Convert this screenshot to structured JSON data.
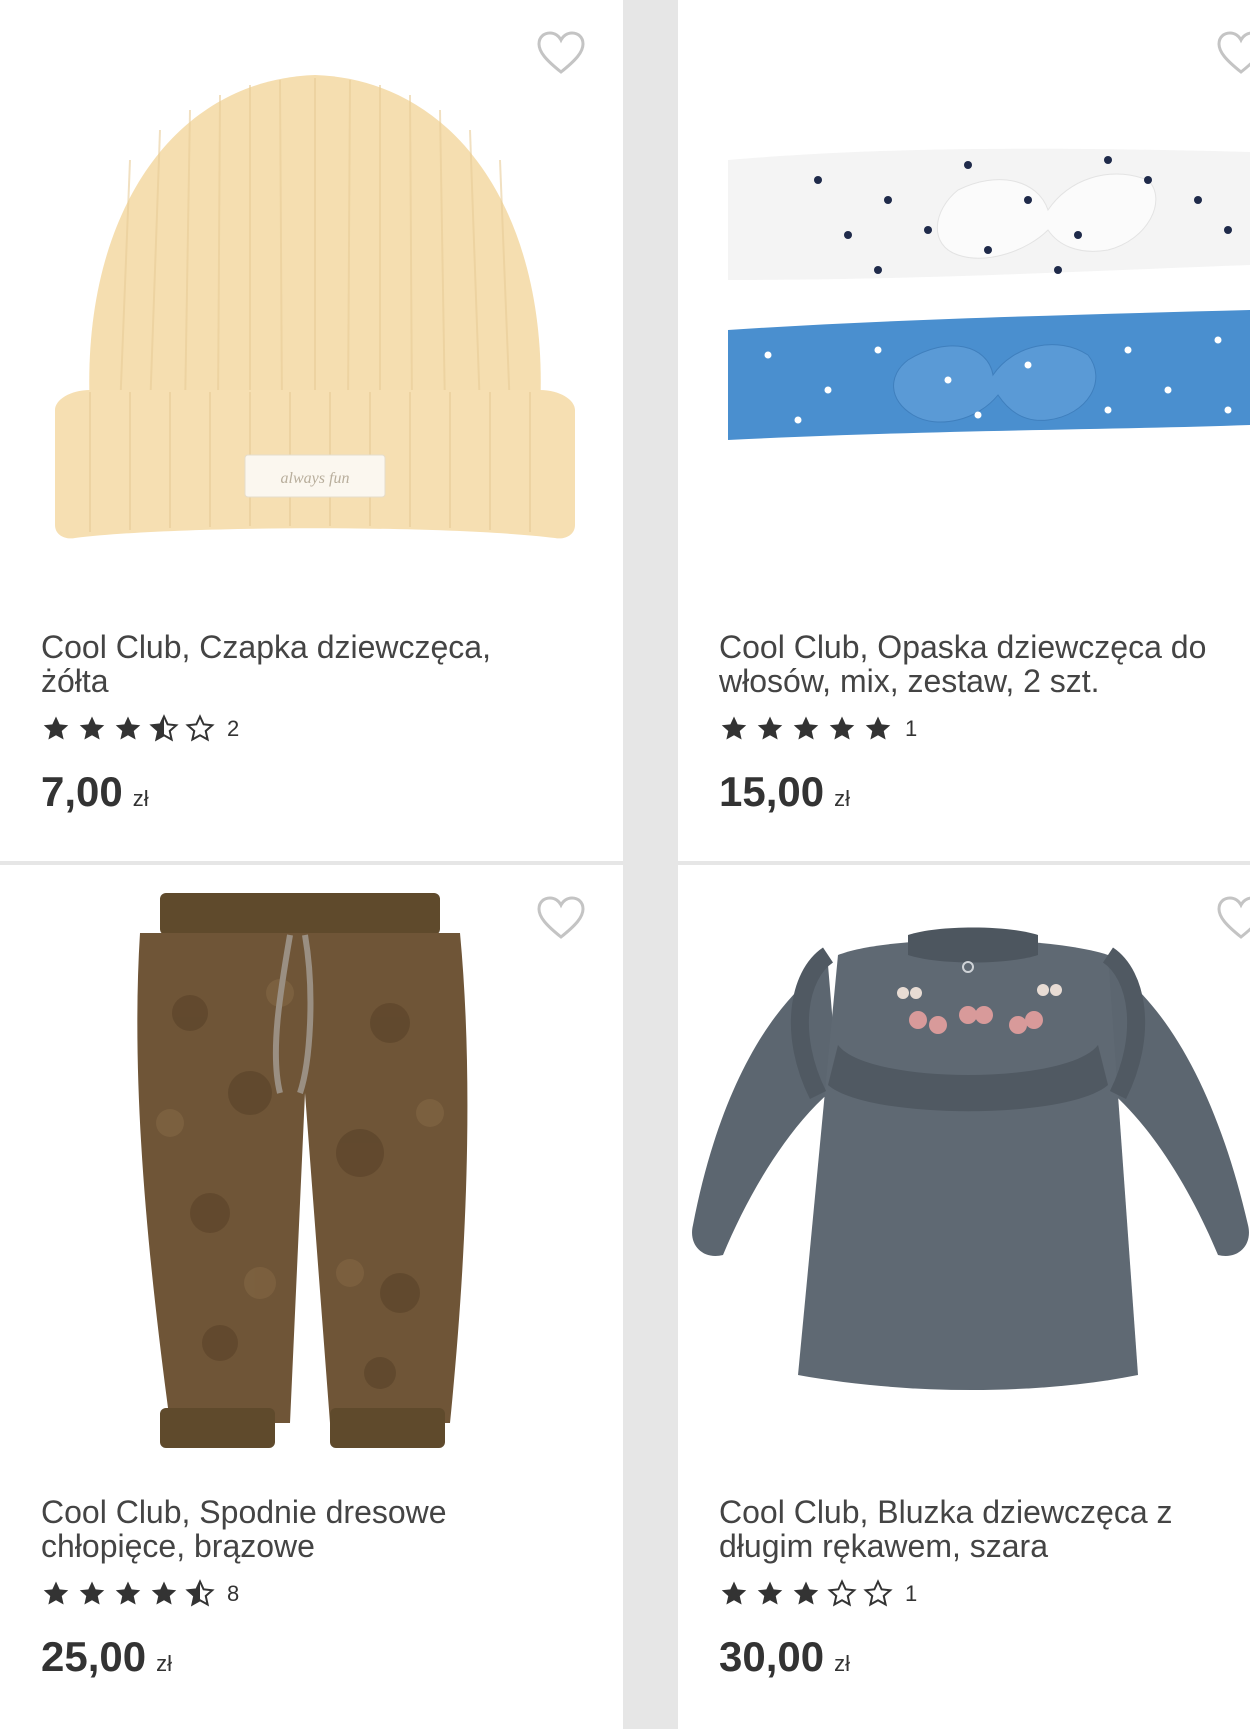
{
  "products": [
    {
      "title": "Cool Club, Czapka dziewczęca, żółta",
      "rating": 3.5,
      "review_count": "2",
      "price": "7,00",
      "currency": "zł",
      "image_label": "yellow-knit-hat",
      "tag_text": "always fun"
    },
    {
      "title": "Cool Club, Opaska dziewczęca do włosów, mix, zestaw, 2 szt.",
      "rating": 5,
      "review_count": "1",
      "price": "15,00",
      "currency": "zł",
      "image_label": "headbands-set"
    },
    {
      "title": "Cool Club, Spodnie dresowe chłopięce, brązowe",
      "rating": 4.5,
      "review_count": "8",
      "price": "25,00",
      "currency": "zł",
      "image_label": "brown-fleece-pants"
    },
    {
      "title": "Cool Club, Bluzka dziewczęca z długim rękawem, szara",
      "rating": 3,
      "review_count": "1",
      "price": "30,00",
      "currency": "zł",
      "image_label": "grey-ruffle-blouse"
    }
  ],
  "colors": {
    "hat": "#f5deb0",
    "headband_white": "#f4f4f4",
    "headband_blue": "#4a8fcf",
    "pants": "#6f5537",
    "blouse": "#5c6670",
    "star": "#333333"
  }
}
